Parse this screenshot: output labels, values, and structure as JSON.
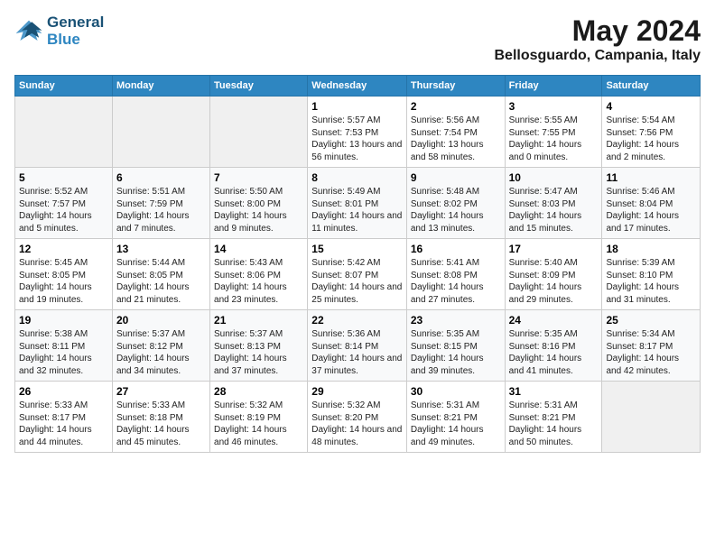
{
  "logo": {
    "line1": "General",
    "line2": "Blue"
  },
  "title": "May 2024",
  "location": "Bellosguardo, Campania, Italy",
  "days_of_week": [
    "Sunday",
    "Monday",
    "Tuesday",
    "Wednesday",
    "Thursday",
    "Friday",
    "Saturday"
  ],
  "weeks": [
    [
      {
        "day": "",
        "sunrise": "",
        "sunset": "",
        "daylight": "",
        "empty": true
      },
      {
        "day": "",
        "sunrise": "",
        "sunset": "",
        "daylight": "",
        "empty": true
      },
      {
        "day": "",
        "sunrise": "",
        "sunset": "",
        "daylight": "",
        "empty": true
      },
      {
        "day": "1",
        "sunrise": "Sunrise: 5:57 AM",
        "sunset": "Sunset: 7:53 PM",
        "daylight": "Daylight: 13 hours and 56 minutes."
      },
      {
        "day": "2",
        "sunrise": "Sunrise: 5:56 AM",
        "sunset": "Sunset: 7:54 PM",
        "daylight": "Daylight: 13 hours and 58 minutes."
      },
      {
        "day": "3",
        "sunrise": "Sunrise: 5:55 AM",
        "sunset": "Sunset: 7:55 PM",
        "daylight": "Daylight: 14 hours and 0 minutes."
      },
      {
        "day": "4",
        "sunrise": "Sunrise: 5:54 AM",
        "sunset": "Sunset: 7:56 PM",
        "daylight": "Daylight: 14 hours and 2 minutes."
      }
    ],
    [
      {
        "day": "5",
        "sunrise": "Sunrise: 5:52 AM",
        "sunset": "Sunset: 7:57 PM",
        "daylight": "Daylight: 14 hours and 5 minutes."
      },
      {
        "day": "6",
        "sunrise": "Sunrise: 5:51 AM",
        "sunset": "Sunset: 7:59 PM",
        "daylight": "Daylight: 14 hours and 7 minutes."
      },
      {
        "day": "7",
        "sunrise": "Sunrise: 5:50 AM",
        "sunset": "Sunset: 8:00 PM",
        "daylight": "Daylight: 14 hours and 9 minutes."
      },
      {
        "day": "8",
        "sunrise": "Sunrise: 5:49 AM",
        "sunset": "Sunset: 8:01 PM",
        "daylight": "Daylight: 14 hours and 11 minutes."
      },
      {
        "day": "9",
        "sunrise": "Sunrise: 5:48 AM",
        "sunset": "Sunset: 8:02 PM",
        "daylight": "Daylight: 14 hours and 13 minutes."
      },
      {
        "day": "10",
        "sunrise": "Sunrise: 5:47 AM",
        "sunset": "Sunset: 8:03 PM",
        "daylight": "Daylight: 14 hours and 15 minutes."
      },
      {
        "day": "11",
        "sunrise": "Sunrise: 5:46 AM",
        "sunset": "Sunset: 8:04 PM",
        "daylight": "Daylight: 14 hours and 17 minutes."
      }
    ],
    [
      {
        "day": "12",
        "sunrise": "Sunrise: 5:45 AM",
        "sunset": "Sunset: 8:05 PM",
        "daylight": "Daylight: 14 hours and 19 minutes."
      },
      {
        "day": "13",
        "sunrise": "Sunrise: 5:44 AM",
        "sunset": "Sunset: 8:05 PM",
        "daylight": "Daylight: 14 hours and 21 minutes."
      },
      {
        "day": "14",
        "sunrise": "Sunrise: 5:43 AM",
        "sunset": "Sunset: 8:06 PM",
        "daylight": "Daylight: 14 hours and 23 minutes."
      },
      {
        "day": "15",
        "sunrise": "Sunrise: 5:42 AM",
        "sunset": "Sunset: 8:07 PM",
        "daylight": "Daylight: 14 hours and 25 minutes."
      },
      {
        "day": "16",
        "sunrise": "Sunrise: 5:41 AM",
        "sunset": "Sunset: 8:08 PM",
        "daylight": "Daylight: 14 hours and 27 minutes."
      },
      {
        "day": "17",
        "sunrise": "Sunrise: 5:40 AM",
        "sunset": "Sunset: 8:09 PM",
        "daylight": "Daylight: 14 hours and 29 minutes."
      },
      {
        "day": "18",
        "sunrise": "Sunrise: 5:39 AM",
        "sunset": "Sunset: 8:10 PM",
        "daylight": "Daylight: 14 hours and 31 minutes."
      }
    ],
    [
      {
        "day": "19",
        "sunrise": "Sunrise: 5:38 AM",
        "sunset": "Sunset: 8:11 PM",
        "daylight": "Daylight: 14 hours and 32 minutes."
      },
      {
        "day": "20",
        "sunrise": "Sunrise: 5:37 AM",
        "sunset": "Sunset: 8:12 PM",
        "daylight": "Daylight: 14 hours and 34 minutes."
      },
      {
        "day": "21",
        "sunrise": "Sunrise: 5:37 AM",
        "sunset": "Sunset: 8:13 PM",
        "daylight": "Daylight: 14 hours and 37 minutes."
      },
      {
        "day": "22",
        "sunrise": "Sunrise: 5:36 AM",
        "sunset": "Sunset: 8:14 PM",
        "daylight": "Daylight: 14 hours and 37 minutes."
      },
      {
        "day": "23",
        "sunrise": "Sunrise: 5:35 AM",
        "sunset": "Sunset: 8:15 PM",
        "daylight": "Daylight: 14 hours and 39 minutes."
      },
      {
        "day": "24",
        "sunrise": "Sunrise: 5:35 AM",
        "sunset": "Sunset: 8:16 PM",
        "daylight": "Daylight: 14 hours and 41 minutes."
      },
      {
        "day": "25",
        "sunrise": "Sunrise: 5:34 AM",
        "sunset": "Sunset: 8:17 PM",
        "daylight": "Daylight: 14 hours and 42 minutes."
      }
    ],
    [
      {
        "day": "26",
        "sunrise": "Sunrise: 5:33 AM",
        "sunset": "Sunset: 8:17 PM",
        "daylight": "Daylight: 14 hours and 44 minutes."
      },
      {
        "day": "27",
        "sunrise": "Sunrise: 5:33 AM",
        "sunset": "Sunset: 8:18 PM",
        "daylight": "Daylight: 14 hours and 45 minutes."
      },
      {
        "day": "28",
        "sunrise": "Sunrise: 5:32 AM",
        "sunset": "Sunset: 8:19 PM",
        "daylight": "Daylight: 14 hours and 46 minutes."
      },
      {
        "day": "29",
        "sunrise": "Sunrise: 5:32 AM",
        "sunset": "Sunset: 8:20 PM",
        "daylight": "Daylight: 14 hours and 48 minutes."
      },
      {
        "day": "30",
        "sunrise": "Sunrise: 5:31 AM",
        "sunset": "Sunset: 8:21 PM",
        "daylight": "Daylight: 14 hours and 49 minutes."
      },
      {
        "day": "31",
        "sunrise": "Sunrise: 5:31 AM",
        "sunset": "Sunset: 8:21 PM",
        "daylight": "Daylight: 14 hours and 50 minutes."
      },
      {
        "day": "",
        "sunrise": "",
        "sunset": "",
        "daylight": "",
        "empty": true
      }
    ]
  ]
}
